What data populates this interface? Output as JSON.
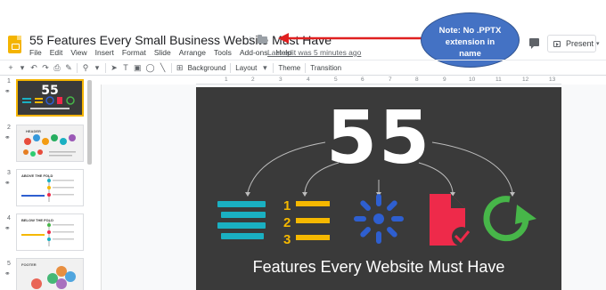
{
  "header": {
    "title": "55 Features Every Small Business Website Must Have",
    "last_edit": "Last edit was 5 minutes ago",
    "present_label": "Present"
  },
  "menu": [
    "File",
    "Edit",
    "View",
    "Insert",
    "Format",
    "Slide",
    "Arrange",
    "Tools",
    "Add-ons",
    "Help"
  ],
  "annotation": {
    "text_line1": "Note: No .PPTX",
    "text_line2": "extension in",
    "text_line3": "name"
  },
  "toolbar": {
    "background_label": "Background",
    "layout_label": "Layout",
    "theme_label": "Theme",
    "transition_label": "Transition"
  },
  "ruler": [
    "1",
    "2",
    "3",
    "4",
    "5",
    "6",
    "7",
    "8",
    "9",
    "10",
    "11",
    "12",
    "13"
  ],
  "slides": [
    {
      "num": "1",
      "title": "55",
      "caption": "Features Every Website Must Have"
    },
    {
      "num": "2",
      "title": "HEADER"
    },
    {
      "num": "3",
      "title": "ABOVE THE FOLD"
    },
    {
      "num": "4",
      "title": "BELOW THE FOLD"
    },
    {
      "num": "5",
      "title": "FOOTER"
    }
  ],
  "main_slide": {
    "big_text": "55",
    "subtitle": "Features Every Website Must Have",
    "list_numbers": [
      "1",
      "2",
      "3"
    ]
  },
  "colors": {
    "slide_bg": "#3a3a3a",
    "teal": "#1ab0c2",
    "yellow": "#f5b800",
    "blue": "#2e5fd0",
    "red": "#ee2a4a",
    "green": "#47b649",
    "note_bg": "#4472c4",
    "arrow": "#e02020"
  }
}
